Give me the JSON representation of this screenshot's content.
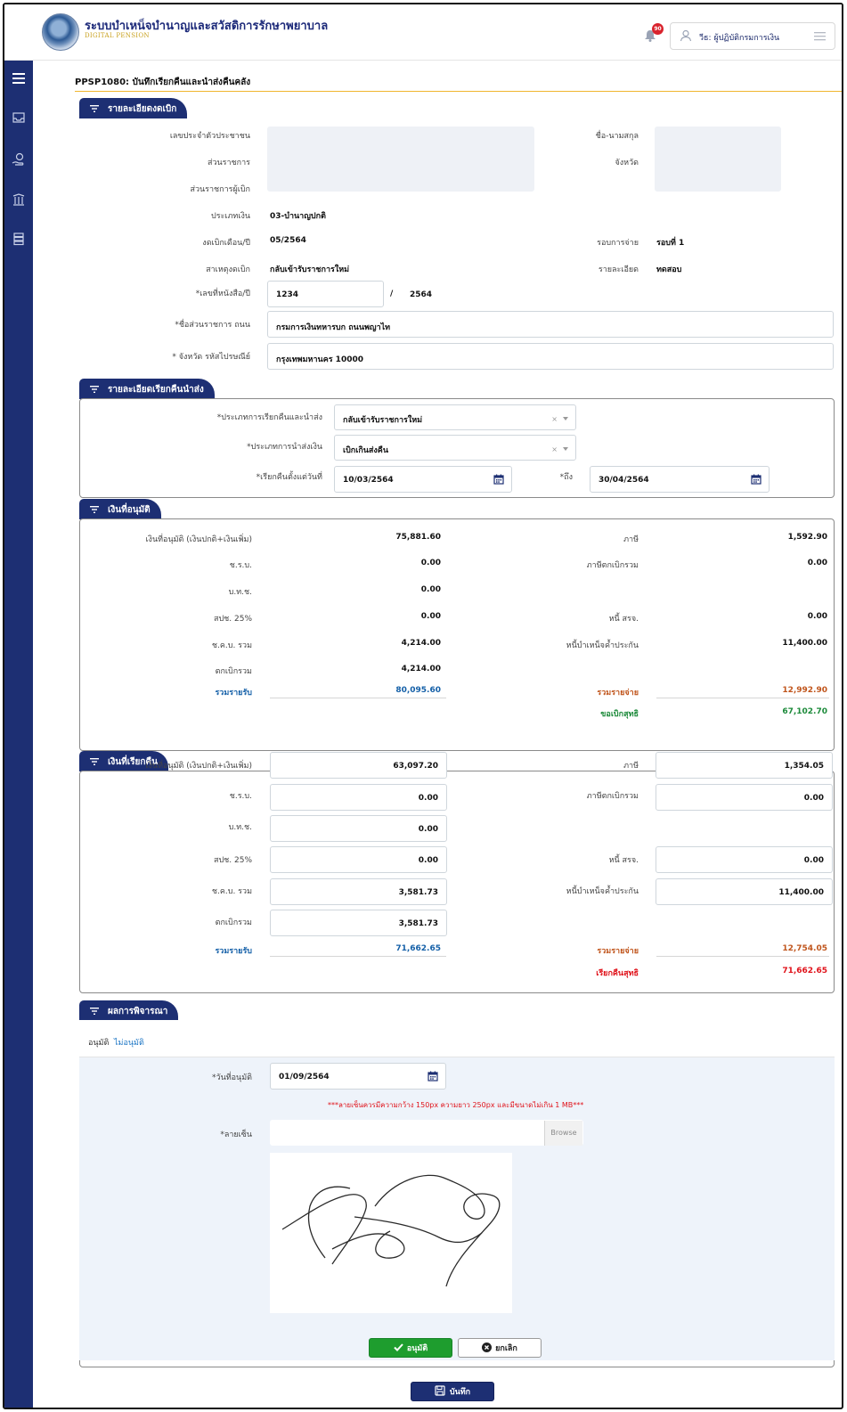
{
  "header": {
    "app_title": "ระบบบำเหน็จบำนาญและสวัสดิการรักษาพยาบาล",
    "app_subtitle": "DIGITAL PENSION",
    "notification_count": "90",
    "user_role": "วีธ: ผู้ปฏิบัติกรมการเงิน",
    "icon_names": [
      "logo",
      "bell-icon",
      "user-icon",
      "menu-icon"
    ]
  },
  "sidebar": {
    "icon_names": [
      "hamburger-icon",
      "inbox-icon",
      "money-hand-icon",
      "pension-icon",
      "database-icon"
    ]
  },
  "page": {
    "title": "PPSP1080: บันทึกเรียกคืนและนำส่งคืนคลัง"
  },
  "detail": {
    "tab": "รายละเอียดงดเบิก",
    "id_label": "เลขประจำตัวประชาชน",
    "name_label": "ชื่อ-นามสกุล",
    "agency_label": "ส่วนราชการ",
    "province_label": "จังหวัด",
    "payer_label": "ส่วนราชการผู้เบิก",
    "money_type_label": "ประเภทเงิน",
    "money_type_value": "03-บำนาญปกติ",
    "period_label": "งดเบิกเดือน/ปี",
    "period_value": "05/2564",
    "round_label": "รอบการจ่าย",
    "round_value": "รอบที่ 1",
    "reason_label": "สาเหตุงดเบิก",
    "reason_value": "กลับเข้ารับราชการใหม่",
    "remark_label": "รายละเอียด",
    "remark_value": "ทดสอบ",
    "doc_label": "*เลขที่หนังสือ/ปี",
    "doc_no": "1234",
    "doc_sep": "/",
    "doc_year": "2564",
    "office_label": "*ชื่อส่วนราชการ ถนน",
    "office_value": "กรมการเงินทหารบก ถนนพญาไท",
    "postal_label": "* จังหวัด รหัสไปรษณีย์",
    "postal_value": "กรุงเทพมหานคร 10000"
  },
  "recall_detail": {
    "tab": "รายละเอียดเรียกคืนนำส่ง",
    "recall_type_label": "*ประเภทการเรียกคืนและนำส่ง",
    "recall_type_value": "กลับเข้ารับราชการใหม่",
    "send_type_label": "*ประเภทการนำส่งเงิน",
    "send_type_value": "เบิกเกินส่งคืน",
    "from_label": "*เรียกคืนตั้งแต่วันที่",
    "from_value": "10/03/2564",
    "to_label": "*ถึง",
    "to_value": "30/04/2564",
    "clear_glyph": "×"
  },
  "approved": {
    "tab": "เงินที่อนุมัติ",
    "rows": [
      {
        "label": "เงินที่อนุมัติ (เงินปกติ+เงินเพิ่ม)",
        "value": "75,881.60",
        "r_label": "ภาษี",
        "r_value": "1,592.90"
      },
      {
        "label": "ช.ร.บ.",
        "value": "0.00",
        "r_label": "ภาษีตกเบิกรวม",
        "r_value": "0.00"
      },
      {
        "label": "บ.ท.ช.",
        "value": "0.00",
        "r_label": "",
        "r_value": ""
      },
      {
        "label": "สปช. 25%",
        "value": "0.00",
        "r_label": "หนี้ สรจ.",
        "r_value": "0.00"
      },
      {
        "label": "ช.ค.บ. รวม",
        "value": "4,214.00",
        "r_label": "หนี้บำเหน็จค้ำประกัน",
        "r_value": "11,400.00"
      },
      {
        "label": "ตกเบิกรวม",
        "value": "4,214.00",
        "r_label": "",
        "r_value": ""
      }
    ],
    "total_in_label": "รวมรายรับ",
    "total_in_value": "80,095.60",
    "total_out_label": "รวมรายจ่าย",
    "total_out_value": "12,992.90",
    "net_label": "ขอเบิกสุทธิ",
    "net_value": "67,102.70"
  },
  "recalled": {
    "tab": "เงินที่เรียกคืน",
    "rows": [
      {
        "label": "เงินที่อนุมัติ (เงินปกติ+เงินเพิ่ม)",
        "value": "63,097.20",
        "r_label": "ภาษี",
        "r_value": "1,354.05"
      },
      {
        "label": "ช.ร.บ.",
        "value": "0.00",
        "r_label": "ภาษีตกเบิกรวม",
        "r_value": "0.00"
      },
      {
        "label": "บ.ท.ช.",
        "value": "0.00",
        "r_label": "",
        "r_value": ""
      },
      {
        "label": "สปช. 25%",
        "value": "0.00",
        "r_label": "หนี้ สรจ.",
        "r_value": "0.00"
      },
      {
        "label": "ช.ค.บ. รวม",
        "value": "3,581.73",
        "r_label": "หนี้บำเหน็จค้ำประกัน",
        "r_value": "11,400.00"
      },
      {
        "label": "ตกเบิกรวม",
        "value": "3,581.73",
        "r_label": "",
        "r_value": ""
      }
    ],
    "total_in_label": "รวมรายรับ",
    "total_in_value": "71,662.65",
    "total_out_label": "รวมรายจ่าย",
    "total_out_value": "12,754.05",
    "net_label": "เรียกคืนสุทธิ",
    "net_value": "71,662.65"
  },
  "result": {
    "tab": "ผลการพิจารณา",
    "tab_approve": "อนุมัติ",
    "tab_reject": "ไม่อนุมัติ",
    "approve_date_label": "*วันที่อนุมัติ",
    "approve_date_value": "01/09/2564",
    "signature_note": "***ลายเซ็นควรมีความกว้าง 150px ความยาว 250px และมีขนาดไม่เกิน 1 MB***",
    "signature_label": "*ลายเซ็น",
    "signature_value": "",
    "browse": "Browse",
    "approve_button": "อนุมัติ",
    "cancel_button": "ยกเลิก"
  },
  "footer": {
    "save_button": "บันทึก"
  },
  "colors": {
    "navy": "#1d2f73",
    "gold": "#f0b62f",
    "income_blue": "#1560a8",
    "expense_orange": "#c0551c",
    "net_green": "#1c8a3a",
    "net_red": "#e0121a",
    "approve_green": "#1e9d2e"
  }
}
